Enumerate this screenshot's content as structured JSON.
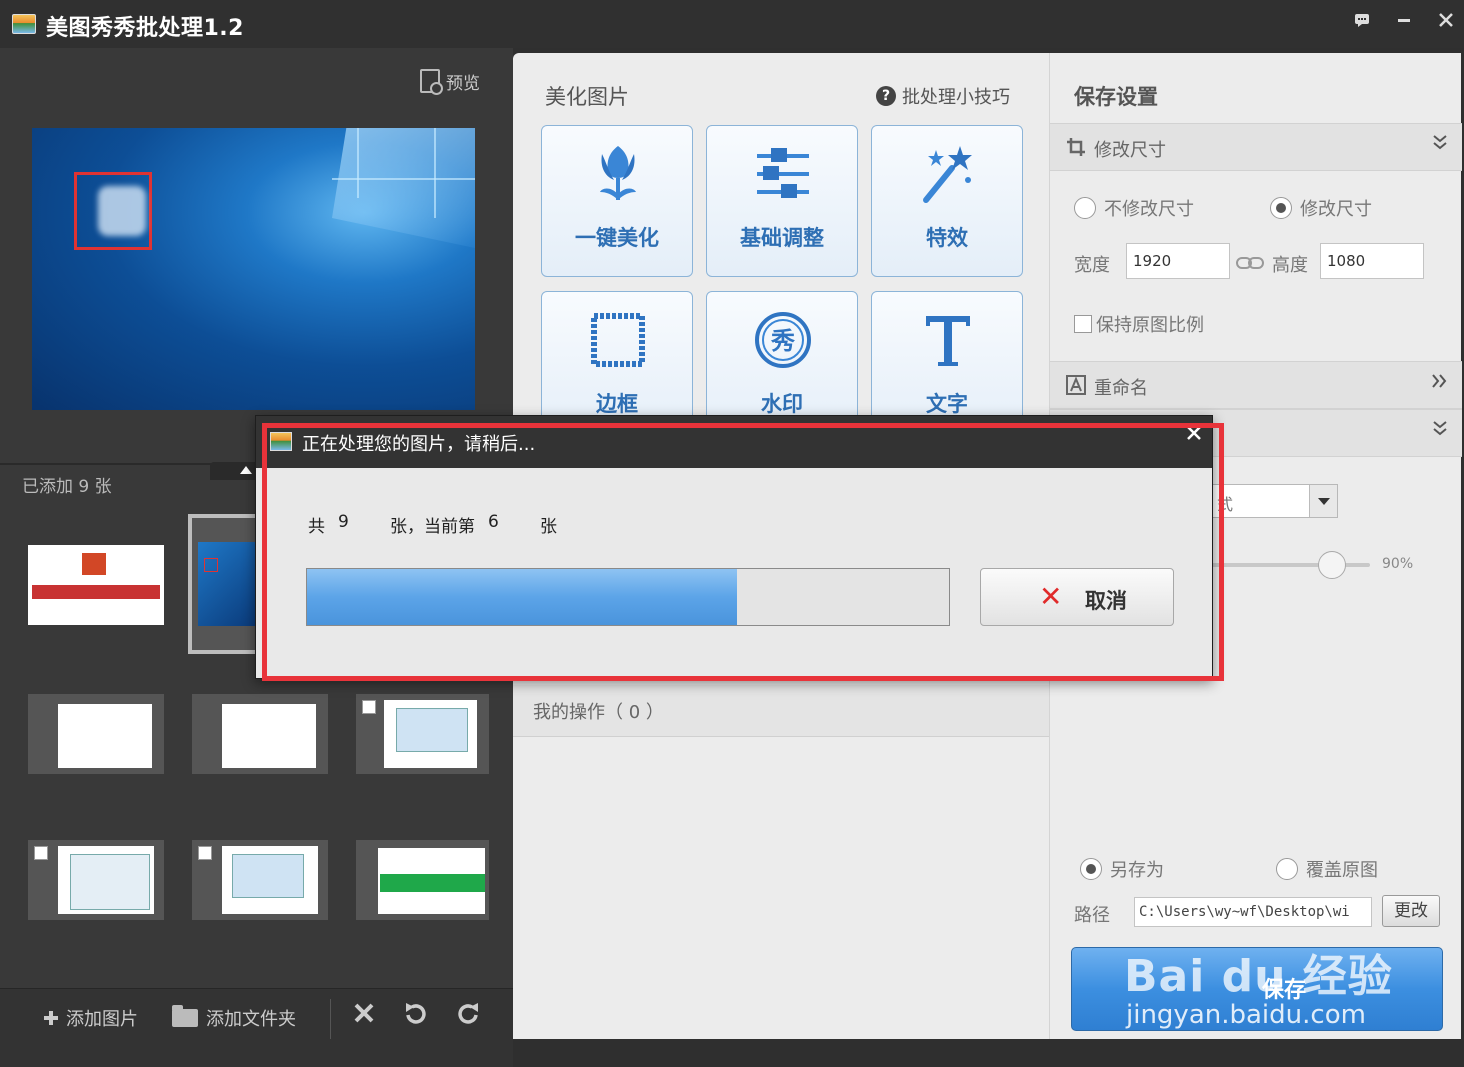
{
  "window": {
    "title": "美图秀秀批处理1.2",
    "controls": [
      "feedback-icon",
      "minimize-icon",
      "close-icon"
    ]
  },
  "left": {
    "preview_label": "预览",
    "added_count": "已添加 9 张",
    "thumbnails": 9,
    "selected_thumbnail": 2,
    "add_image_label": "添加图片",
    "add_folder_label": "添加文件夹",
    "tools": [
      "delete-icon",
      "rotate-left-icon",
      "rotate-right-icon"
    ]
  },
  "middle": {
    "title": "美化图片",
    "tips_label": "批处理小技巧",
    "tools": [
      {
        "label": "一键美化",
        "icon": "tulip-icon"
      },
      {
        "label": "基础调整",
        "icon": "sliders-icon"
      },
      {
        "label": "特效",
        "icon": "magic-wand-icon"
      },
      {
        "label": "边框",
        "icon": "frame-icon"
      },
      {
        "label": "水印",
        "icon": "watermark-icon"
      },
      {
        "label": "文字",
        "icon": "text-icon"
      }
    ],
    "ops_label": "我的操作（ 0 ）"
  },
  "right": {
    "title": "保存设置",
    "resize": {
      "header": "修改尺寸",
      "option_keep": "不修改尺寸",
      "option_change": "修改尺寸",
      "selected": "change",
      "width_label": "宽度",
      "width_value": "1920",
      "height_label": "高度",
      "height_value": "1080",
      "keep_ratio_label": "保持原图比例",
      "keep_ratio_checked": false
    },
    "rename_header": "重命名",
    "format_select_visible_text": "式",
    "quality_value": "90%",
    "quality_fraction": 0.9,
    "save_as_label": "另存为",
    "overwrite_label": "覆盖原图",
    "save_mode": "save-as",
    "path_label": "路径",
    "path_value": "C:\\Users\\wy~wf\\Desktop\\wi",
    "change_label": "更改",
    "save_label": "保存"
  },
  "dialog": {
    "title": "正在处理您的图片，请稍后...",
    "total_prefix": "共",
    "total": "9",
    "current_prefix": "张，当前第",
    "current": "6",
    "suffix": "张",
    "progress_fraction": 0.67,
    "cancel_label": "取消"
  },
  "watermark": {
    "main": "Bai du 经验",
    "sub": "jingyan.baidu.com"
  },
  "colors": {
    "accent_blue": "#3c8fe0",
    "highlight_red": "#e8333a",
    "cancel_red": "#e02a2a",
    "tool_label_blue": "#2e6fb4"
  }
}
